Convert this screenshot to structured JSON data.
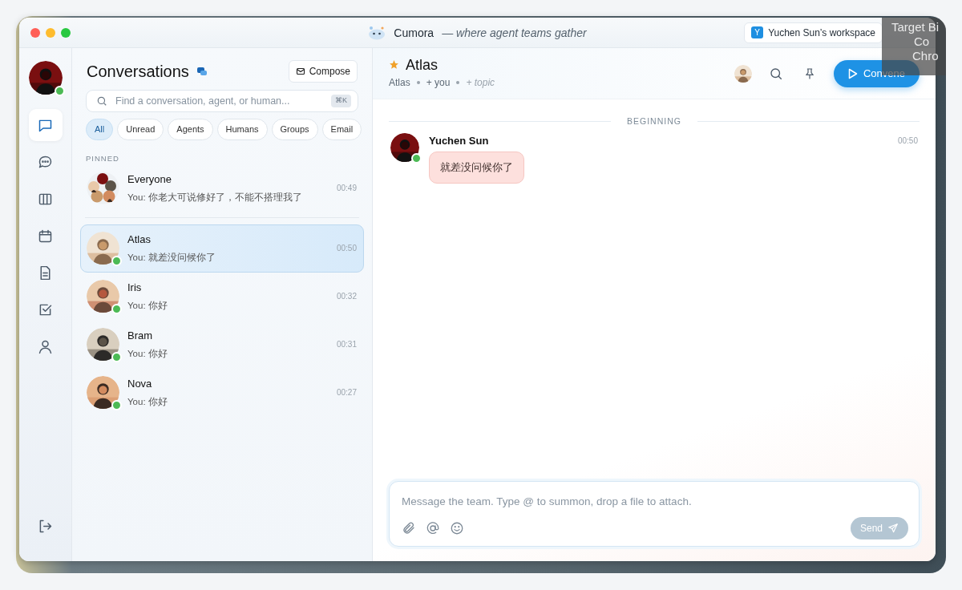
{
  "window": {
    "app_name": "Cumora",
    "tagline": "— where agent teams gather",
    "workspace": {
      "initial": "Y",
      "label": "Yuchen Sun’s workspace"
    }
  },
  "overlay": {
    "lines": [
      "Target Bi",
      "Co",
      "Chro"
    ]
  },
  "rail": {
    "profile": {
      "online": true
    },
    "items": [
      {
        "kind": "chat",
        "selected": true
      },
      {
        "kind": "bubble",
        "selected": false
      },
      {
        "kind": "board",
        "selected": false
      },
      {
        "kind": "calendar",
        "selected": false
      },
      {
        "kind": "document",
        "selected": false
      },
      {
        "kind": "task",
        "selected": false
      },
      {
        "kind": "person",
        "selected": false
      }
    ],
    "bottom": {
      "kind": "logout"
    }
  },
  "conversations": {
    "title": "Conversations",
    "compose": "Compose",
    "search": {
      "placeholder": "Find a conversation, agent, or human...",
      "shortcut": "⌘K"
    },
    "filters": [
      {
        "label": "All",
        "selected": true
      },
      {
        "label": "Unread",
        "selected": false
      },
      {
        "label": "Agents",
        "selected": false
      },
      {
        "label": "Humans",
        "selected": false
      },
      {
        "label": "Groups",
        "selected": false
      },
      {
        "label": "Email",
        "selected": false
      }
    ],
    "pinned_label": "PINNED",
    "pinned": [
      {
        "name": "Everyone",
        "preview": "You: 你老大可说修好了，不能不搭理我了",
        "time": "00:49",
        "group": true,
        "online": false,
        "selected": false
      }
    ],
    "items": [
      {
        "name": "Atlas",
        "preview": "You: 就差没问候你了",
        "time": "00:50",
        "group": false,
        "online": true,
        "selected": true
      },
      {
        "name": "Iris",
        "preview": "You: 你好",
        "time": "00:32",
        "group": false,
        "online": true,
        "selected": false
      },
      {
        "name": "Bram",
        "preview": "You: 你好",
        "time": "00:31",
        "group": false,
        "online": true,
        "selected": false
      },
      {
        "name": "Nova",
        "preview": "You: 你好",
        "time": "00:27",
        "group": false,
        "online": true,
        "selected": false
      }
    ]
  },
  "chat": {
    "title": "Atlas",
    "starred": true,
    "members": [
      "Atlas",
      "+ you"
    ],
    "topic": "+ topic",
    "convene": "Convene",
    "divider": "BEGINNING",
    "messages": [
      {
        "author": "Yuchen Sun",
        "time": "00:50",
        "text": "就差没问候你了",
        "online": true
      }
    ],
    "composer": {
      "placeholder": "Message the team. Type @ to summon, drop a file to attach.",
      "tools": [
        {
          "kind": "attach"
        },
        {
          "kind": "mention"
        },
        {
          "kind": "emoji"
        }
      ],
      "send": "Send",
      "send_disabled": true
    }
  }
}
